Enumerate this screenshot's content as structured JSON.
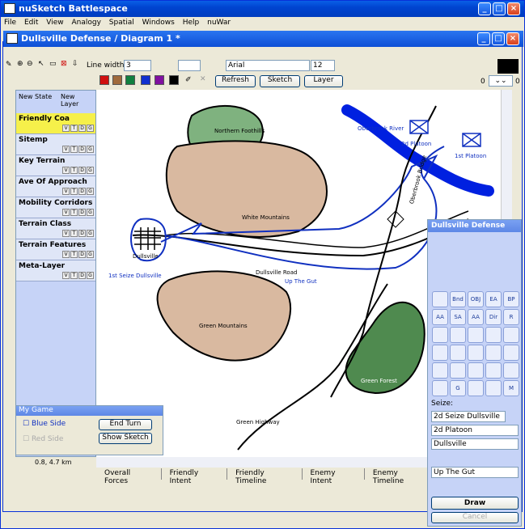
{
  "app": {
    "title": "nuSketch Battlespace",
    "menus": [
      "File",
      "Edit",
      "View",
      "Analogy",
      "Spatial",
      "Windows",
      "Help",
      "nuWar"
    ]
  },
  "doc": {
    "title": "Dullsville Defense / Diagram 1 *"
  },
  "toolbar": {
    "line_width_label": "Line width:",
    "line_width": "3",
    "font": "Arial",
    "font_size": "12",
    "refresh": "Refresh",
    "sketch": "Sketch",
    "layer": "Layer",
    "zoom_min": "0",
    "zoom_max": "0",
    "swatches": [
      "#d01010",
      "#a06a3c",
      "#108040",
      "#1030d0",
      "#8010a0",
      "#000000"
    ]
  },
  "left": {
    "new_state": "New State",
    "new_layer": "New Layer",
    "vtdg": [
      "V",
      "T",
      "D",
      "G"
    ],
    "layers": [
      "Friendly Coa",
      "Sitemp",
      "Key Terrain",
      "Ave Of Approach",
      "Mobility Corridors",
      "Terrain Class",
      "Terrain Features",
      "Meta-Layer"
    ],
    "coords": "0.8, 4.7 km"
  },
  "map": {
    "labels": [
      "Northern Foothills",
      "White Mountains",
      "Green Mountains",
      "Green Forest",
      "Dullsville",
      "1st Seize Dullsville",
      "Dullsville Road",
      "Up The Gut",
      "Green Highway",
      "Oberbrook River",
      "2d Platoon",
      "1st Platoon",
      "Oberbrook Bridge"
    ]
  },
  "tabs": [
    "Overall Forces",
    "Friendly Intent",
    "Friendly Timeline",
    "Enemy Intent",
    "Enemy Timeline"
  ],
  "palette": {
    "title": "Dullsville Defense",
    "glyphs": [
      "",
      "Bnd",
      "OBJ",
      "EA",
      "BP",
      "AA",
      "SA",
      "AA",
      "Dir",
      "R",
      "",
      "",
      "",
      "",
      "",
      "",
      "",
      "",
      "",
      "",
      "",
      "",
      "",
      "",
      "",
      "",
      "G",
      "",
      "",
      "M"
    ],
    "seize_label": "Seize:",
    "seize_value": "2d Seize Dullsville",
    "unit": "2d Platoon",
    "target": "Dullsville",
    "route": "Up The Gut",
    "draw": "Draw",
    "cancel": "Cancel"
  },
  "game": {
    "title": "My Game",
    "blue": "Blue Side",
    "red": "Red Side",
    "end_turn": "End Turn",
    "show_sketch": "Show Sketch"
  }
}
